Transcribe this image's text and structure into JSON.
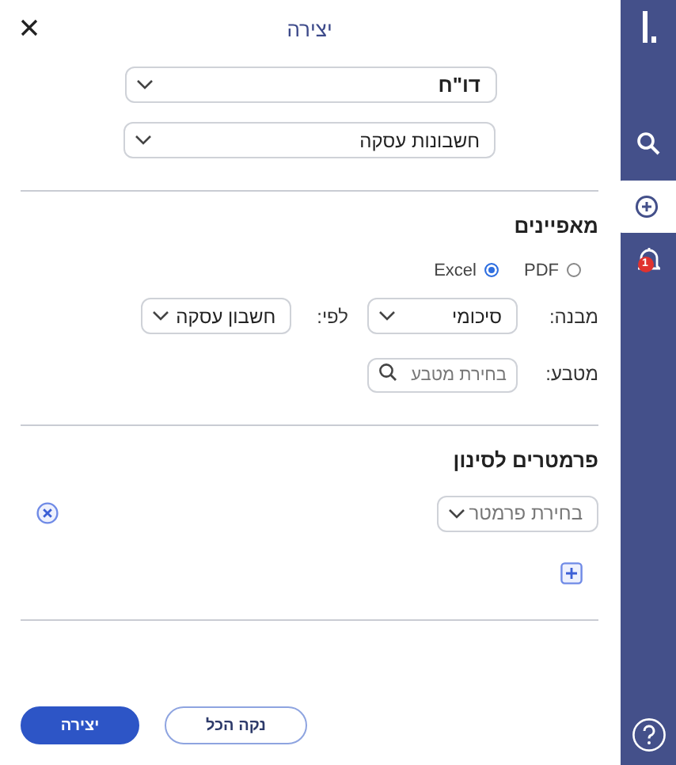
{
  "header": {
    "title": "יצירה"
  },
  "report_type": {
    "value": "דו\"ח"
  },
  "report": {
    "value": "חשבונות עסקה"
  },
  "properties": {
    "heading": "מאפיינים",
    "formats": [
      {
        "label": "PDF",
        "selected": false
      },
      {
        "label": "Excel",
        "selected": true
      }
    ],
    "structure": {
      "label": "מבנה:",
      "value": "סיכומי"
    },
    "group_by": {
      "label": "לפי:",
      "value": "חשבון עסקה"
    },
    "currency": {
      "label": "מטבע:",
      "placeholder": "בחירת מטבע"
    }
  },
  "filters": {
    "heading": "פרמטרים לסינון",
    "params": [
      {
        "placeholder": "בחירת פרמטר"
      }
    ]
  },
  "buttons": [
    {
      "kind": "outline",
      "label": "נקה הכל"
    },
    {
      "kind": "primary",
      "label": "יצירה"
    }
  ],
  "sidebar": {
    "items": [
      {
        "kind": "logo"
      },
      {
        "kind": "search",
        "selected": false
      },
      {
        "kind": "create",
        "selected": true
      },
      {
        "kind": "notifications",
        "selected": false,
        "badge": "1"
      },
      {
        "kind": "help"
      }
    ]
  }
}
